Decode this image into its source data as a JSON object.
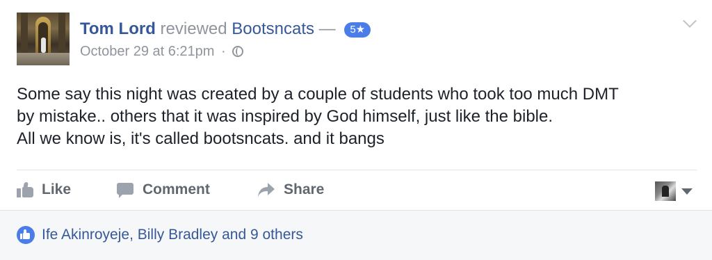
{
  "post": {
    "author": "Tom Lord",
    "verb": "reviewed",
    "page_name": "Bootsncats",
    "dash": "—",
    "rating": "5★",
    "timestamp": "October 29 at 6:21pm",
    "separator": "·",
    "privacy_icon": "globe-icon",
    "menu_icon": "chevron-down-icon",
    "body_lines": [
      "Some say this night was created by a couple of students who took too much DMT",
      "by mistake.. others that it was inspired by God himself, just like the bible.",
      "All we know is, it's called bootsncats. and it bangs"
    ]
  },
  "actions": {
    "like_label": "Like",
    "comment_label": "Comment",
    "share_label": "Share"
  },
  "reactions": {
    "summary": "Ife Akinroyeje, Billy Bradley and 9 others"
  },
  "colors": {
    "link": "#365899",
    "muted": "#90949c",
    "badge": "#4a7de8",
    "footer_bg": "#f6f7f9"
  }
}
